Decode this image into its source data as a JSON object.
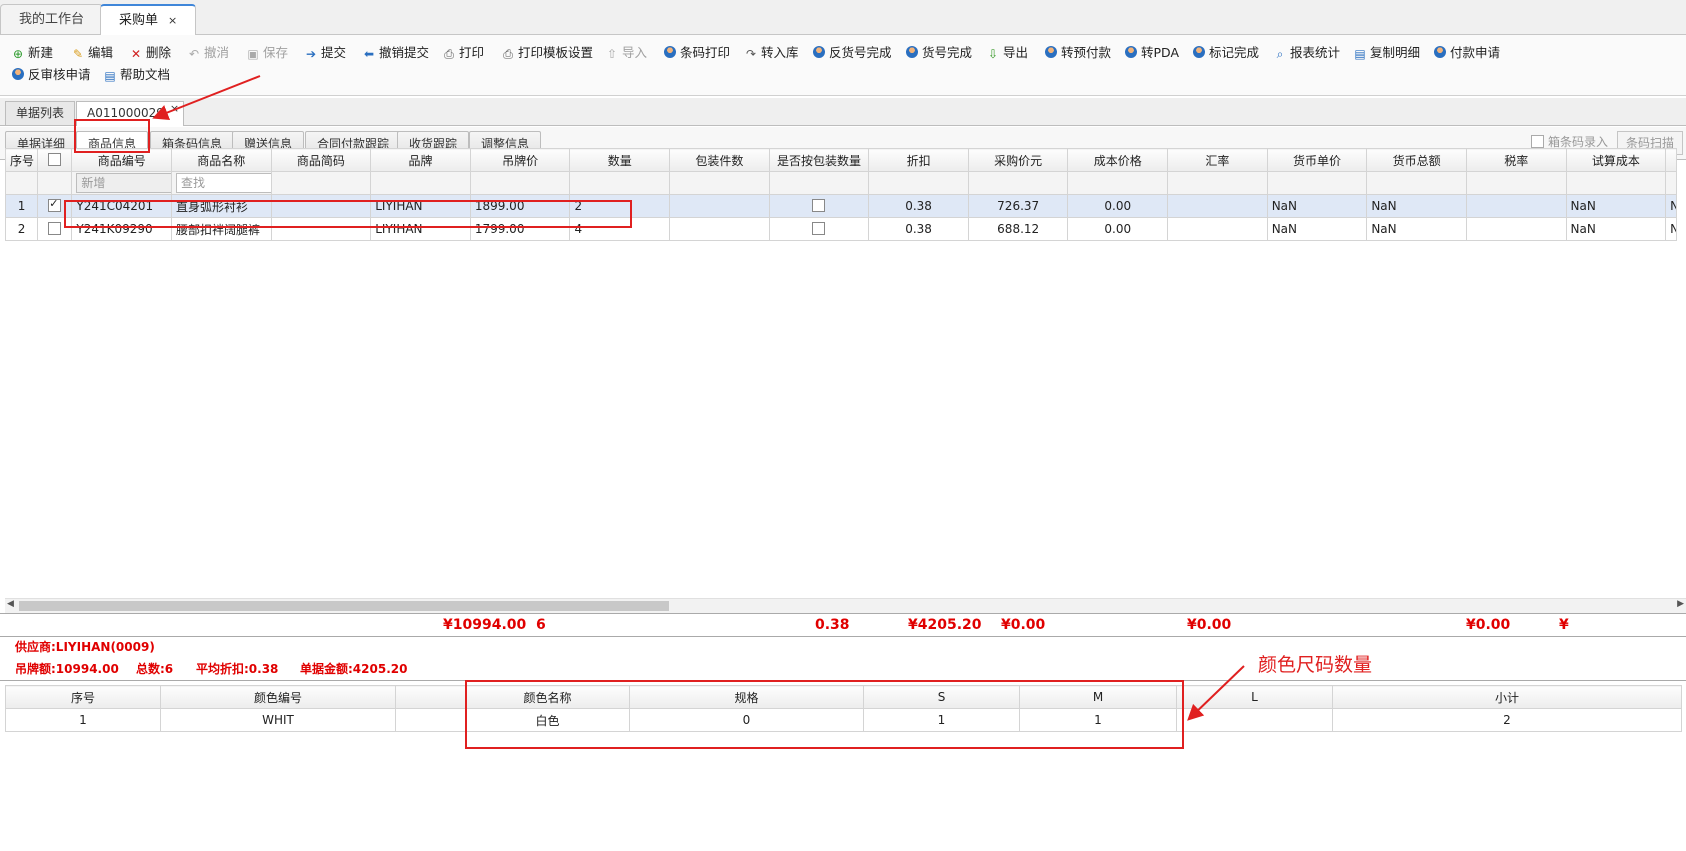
{
  "top_tabs": [
    {
      "label": "我的工作台"
    },
    {
      "label": "采购单",
      "close": "×"
    }
  ],
  "toolbar": [
    {
      "label": "新建",
      "icon": "add-icon",
      "disabled": false
    },
    {
      "label": "编辑",
      "icon": "edit-icon",
      "disabled": false
    },
    {
      "label": "删除",
      "icon": "delete-icon",
      "disabled": false
    },
    {
      "label": "撤消",
      "icon": "undo-icon",
      "disabled": true
    },
    {
      "label": "保存",
      "icon": "save-icon",
      "disabled": true
    },
    {
      "label": "提交",
      "icon": "submit-icon",
      "disabled": false
    },
    {
      "label": "撤销提交",
      "icon": "revoke-icon",
      "disabled": false
    },
    {
      "label": "打印",
      "icon": "print-icon",
      "disabled": false
    },
    {
      "label": "打印模板设置",
      "icon": "print-template-icon",
      "disabled": false
    },
    {
      "label": "导入",
      "icon": "import-icon",
      "disabled": true
    },
    {
      "label": "条码打印",
      "icon": "user-icon",
      "disabled": false
    },
    {
      "label": "转入库",
      "icon": "redo-icon",
      "disabled": false
    },
    {
      "label": "反货号完成",
      "icon": "user-icon",
      "disabled": false
    },
    {
      "label": "货号完成",
      "icon": "user-icon",
      "disabled": false
    },
    {
      "label": "导出",
      "icon": "export-icon",
      "disabled": false
    },
    {
      "label": "转预付款",
      "icon": "user-icon",
      "disabled": false
    },
    {
      "label": "转PDA",
      "icon": "user-icon",
      "disabled": false
    },
    {
      "label": "标记完成",
      "icon": "user-icon",
      "disabled": false
    },
    {
      "label": "报表统计",
      "icon": "search-icon",
      "disabled": false
    },
    {
      "label": "复制明细",
      "icon": "copy-icon",
      "disabled": false
    },
    {
      "label": "付款申请",
      "icon": "user-icon",
      "disabled": false
    },
    {
      "label": "反审核申请",
      "icon": "user-icon",
      "disabled": false
    },
    {
      "label": "帮助文档",
      "icon": "doc-icon",
      "disabled": false
    }
  ],
  "doc_tabs": [
    {
      "label": "单据列表"
    },
    {
      "label": "A011000029",
      "close": "×"
    }
  ],
  "sub_tabs": [
    "单据详细",
    "商品信息",
    "箱条码信息",
    "赠送信息",
    "合同付款跟踪",
    "收货跟踪",
    "调整信息"
  ],
  "box_entry_label": "箱条码录入",
  "scan_button": "条码扫描",
  "grid": {
    "headers": [
      "序号",
      "",
      "商品编号",
      "商品名称",
      "商品简码",
      "品牌",
      "吊牌价",
      "数量",
      "包装件数",
      "是否按包装数量",
      "折扣",
      "采购价元",
      "成本价格",
      "汇率",
      "货币单价",
      "货币总额",
      "税率",
      "试算成本"
    ],
    "filter": {
      "new_placeholder": "新增",
      "search_placeholder": "查找"
    },
    "rows": [
      {
        "no": "1",
        "checked": true,
        "code": "Y241C04201",
        "name": "直身弧形衬衫",
        "short": "",
        "brand": "LIYIHAN",
        "tag_price": "1899.00",
        "qty": "2",
        "pack": "",
        "by_pack": false,
        "discount": "0.38",
        "buy_price": "726.37",
        "cost": "0.00",
        "rate": "",
        "cur_unit": "NaN",
        "cur_total": "NaN",
        "tax": "",
        "trial": "NaN",
        "extra": "N"
      },
      {
        "no": "2",
        "checked": false,
        "code": "Y241K09290",
        "name": "腰部扣袢阔腿裤",
        "short": "",
        "brand": "LIYIHAN",
        "tag_price": "1799.00",
        "qty": "4",
        "pack": "",
        "by_pack": false,
        "discount": "0.38",
        "buy_price": "688.12",
        "cost": "0.00",
        "rate": "",
        "cur_unit": "NaN",
        "cur_total": "NaN",
        "tax": "",
        "trial": "NaN",
        "extra": "N"
      }
    ]
  },
  "totals": {
    "tag_price": "¥10994.00",
    "qty": "6",
    "discount": "0.38",
    "buy_price": "¥4205.20",
    "cost": "¥0.00",
    "cur_unit": "¥0.00",
    "trial": "¥0.00",
    "extra": "¥"
  },
  "summary": {
    "supplier": "供应商:LIYIHAN(0009)",
    "tag_total": "吊牌额:10994.00",
    "count": "总数:6",
    "avg_discount": "平均折扣:0.38",
    "amount": "单据金额:4205.20"
  },
  "size_grid": {
    "headers": [
      "序号",
      "颜色编号",
      "",
      "颜色名称",
      "规格",
      "S",
      "M",
      "L",
      "小计"
    ],
    "rows": [
      [
        "1",
        "WHIT",
        "",
        "白色",
        "0",
        "1",
        "1",
        "",
        "2"
      ]
    ]
  },
  "annotation": "颜色尺码数量",
  "colors": {
    "accent": "#3f86d9",
    "highlight": "#e02020",
    "selected_row": "#dfe8f6"
  }
}
